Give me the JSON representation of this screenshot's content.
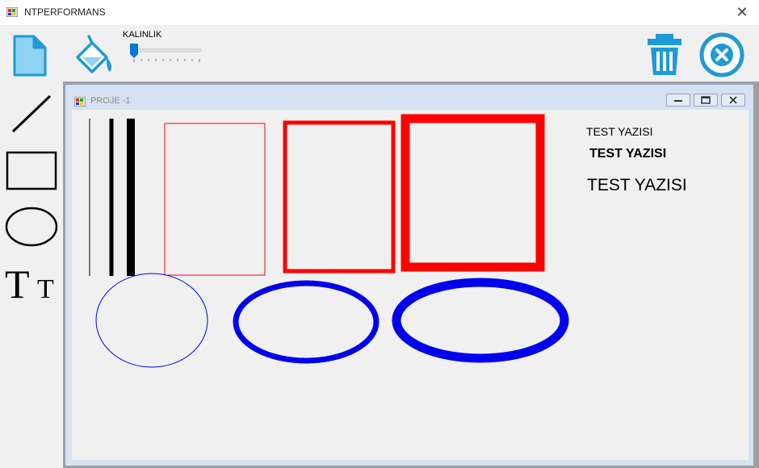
{
  "app": {
    "title": "NTPERFORMANS"
  },
  "toolbar": {
    "new_icon": "new-document-icon",
    "fill_icon": "paint-bucket-icon",
    "slider_label": "KALINLIK",
    "slider_value": 0,
    "delete_icon": "trash-icon",
    "exit_icon": "close-circle-icon"
  },
  "tools": [
    "line-tool",
    "rectangle-tool",
    "ellipse-tool",
    "text-tool"
  ],
  "child_window": {
    "title": "PROJE -1"
  },
  "canvas": {
    "texts": [
      "TEST YAZISI",
      "TEST YAZISI",
      "TEST YAZISI"
    ],
    "colors": {
      "line": "#000000",
      "rect": "#ff0000",
      "ellipse": "#0000ee",
      "accent": "#1e9ad6"
    }
  }
}
